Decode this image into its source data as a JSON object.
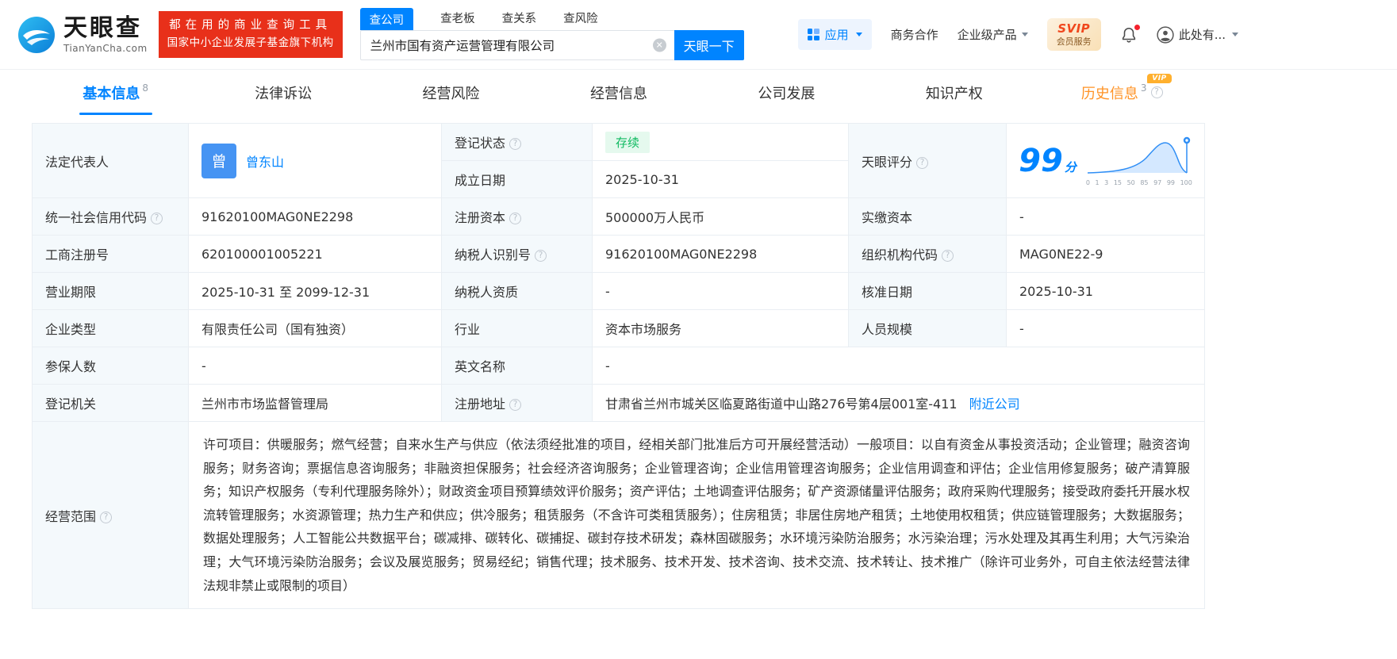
{
  "brand": {
    "name": "天眼查",
    "domain": "TianYanCha.com"
  },
  "banner": {
    "line1": "都在用的商业查询工具",
    "line2": "国家中小企业发展子基金旗下机构"
  },
  "search": {
    "tabs": {
      "company": "查公司",
      "boss": "查老板",
      "relation": "查关系",
      "risk": "查风险"
    },
    "value": "兰州市国有资产运营管理有限公司",
    "button": "天眼一下"
  },
  "header_right": {
    "apps": "应用",
    "cooperation": "商务合作",
    "enterprise": "企业级产品",
    "svip": "SVIP",
    "svip_sub": "会员服务",
    "user": "此处有..."
  },
  "tabs": {
    "basic": {
      "label": "基本信息",
      "count": "8"
    },
    "legal": "法律诉讼",
    "risk": "经营风险",
    "operation": "经营信息",
    "development": "公司发展",
    "ip": "知识产权",
    "history": {
      "label": "历史信息",
      "count": "3",
      "vip": "VIP"
    }
  },
  "score": {
    "label": "天眼评分",
    "value": "99",
    "unit": "分",
    "axis_ticks": [
      "0",
      "1",
      "3",
      "15",
      "50",
      "85",
      "97",
      "99",
      "100"
    ]
  },
  "info": {
    "legal_rep": {
      "label": "法定代表人",
      "avatar": "曾",
      "name": "曾东山"
    },
    "reg_status": {
      "label": "登记状态",
      "value": "存续"
    },
    "establish_date": {
      "label": "成立日期",
      "value": "2025-10-31"
    },
    "credit_code": {
      "label": "统一社会信用代码",
      "value": "91620100MAG0NE2298"
    },
    "reg_capital": {
      "label": "注册资本",
      "value": "500000万人民币"
    },
    "paid_capital": {
      "label": "实缴资本",
      "value": "-"
    },
    "reg_no": {
      "label": "工商注册号",
      "value": "620100001005221"
    },
    "taxpayer_no": {
      "label": "纳税人识别号",
      "value": "91620100MAG0NE2298"
    },
    "org_code": {
      "label": "组织机构代码",
      "value": "MAG0NE22-9"
    },
    "term": {
      "label": "营业期限",
      "value": "2025-10-31 至 2099-12-31"
    },
    "taxpayer_qual": {
      "label": "纳税人资质",
      "value": "-"
    },
    "approve_date": {
      "label": "核准日期",
      "value": "2025-10-31"
    },
    "company_type": {
      "label": "企业类型",
      "value": "有限责任公司（国有独资）"
    },
    "industry": {
      "label": "行业",
      "value": "资本市场服务"
    },
    "staff_size": {
      "label": "人员规模",
      "value": "-"
    },
    "insured": {
      "label": "参保人数",
      "value": "-"
    },
    "en_name": {
      "label": "英文名称",
      "value": "-"
    },
    "authority": {
      "label": "登记机关",
      "value": "兰州市市场监督管理局"
    },
    "address": {
      "label": "注册地址",
      "value": "甘肃省兰州市城关区临夏路街道中山路276号第4层001室-411",
      "nearby": "附近公司"
    },
    "scope": {
      "label": "经营范围",
      "value": "许可项目：供暖服务；燃气经营；自来水生产与供应（依法须经批准的项目，经相关部门批准后方可开展经营活动）一般项目：以自有资金从事投资活动；企业管理；融资咨询服务；财务咨询；票据信息咨询服务；非融资担保服务；社会经济咨询服务；企业管理咨询；企业信用管理咨询服务；企业信用调查和评估；企业信用修复服务；破产清算服务；知识产权服务（专利代理服务除外）；财政资金项目预算绩效评价服务；资产评估；土地调查评估服务；矿产资源储量评估服务；政府采购代理服务；接受政府委托开展水权流转管理服务；水资源管理；热力生产和供应；供冷服务；租赁服务（不含许可类租赁服务）；住房租赁；非居住房地产租赁；土地使用权租赁；供应链管理服务；大数据服务；数据处理服务；人工智能公共数据平台；碳减排、碳转化、碳捕捉、碳封存技术研发；森林固碳服务；水环境污染防治服务；水污染治理；污水处理及其再生利用；大气污染治理；大气环境污染防治服务；会议及展览服务；贸易经纪；销售代理；技术服务、技术开发、技术咨询、技术交流、技术转让、技术推广（除许可业务外，可自主依法经营法律法规非禁止或限制的项目）"
    }
  },
  "colors": {
    "primary": "#0084ff",
    "status_green": "#10ba61",
    "history_orange": "#ff9326",
    "banner_red": "#e8301a"
  }
}
